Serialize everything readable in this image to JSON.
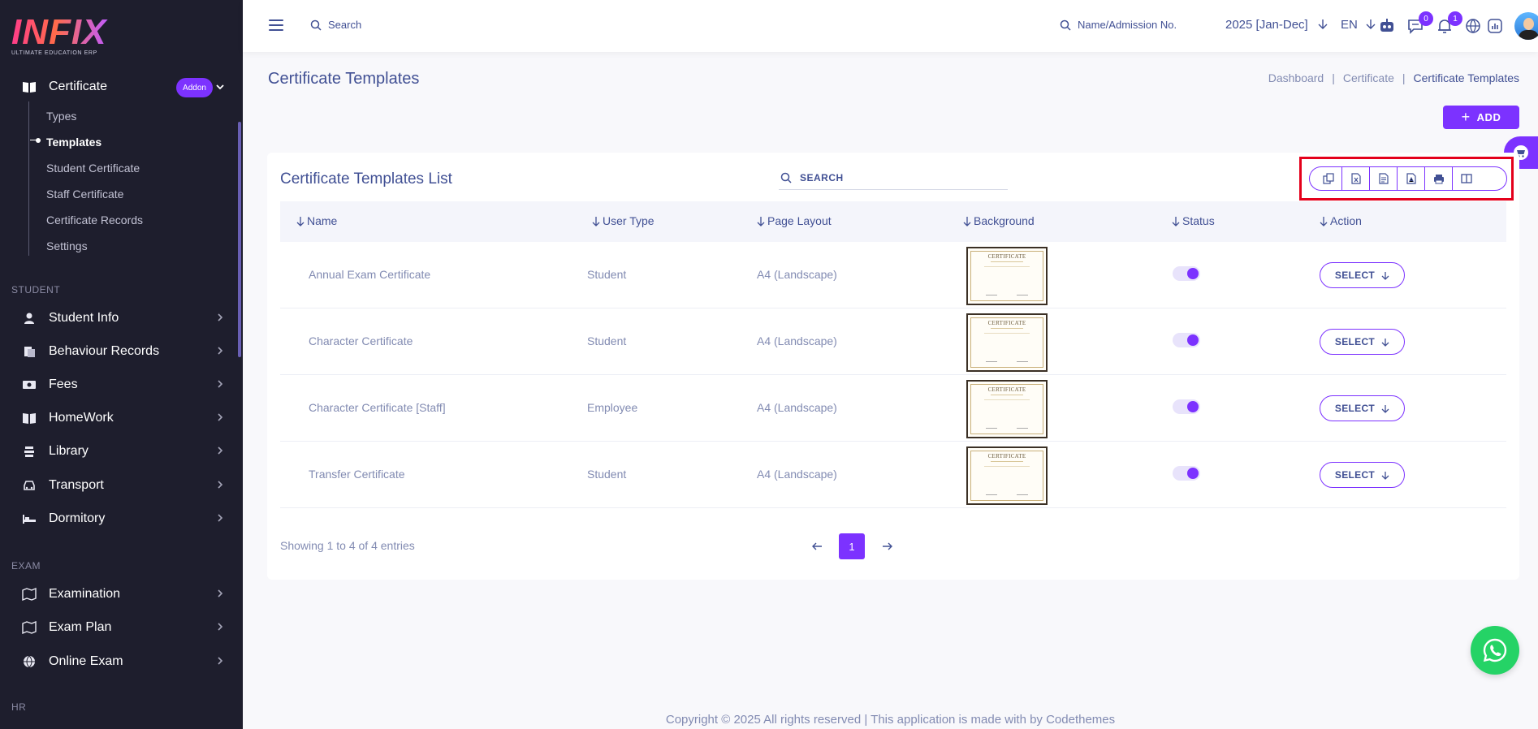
{
  "brand": {
    "name": "INFIX",
    "tagline": "ULTIMATE EDUCATION ERP"
  },
  "sidebar": {
    "certificate": {
      "label": "Certificate",
      "badge": "Addon"
    },
    "sub_items": [
      "Types",
      "Templates",
      "Student Certificate",
      "Staff Certificate",
      "Certificate Records",
      "Settings"
    ],
    "active_sub": "Templates",
    "sections": {
      "student": "STUDENT",
      "exam": "EXAM",
      "hr": "HR"
    },
    "student_items": [
      "Student Info",
      "Behaviour Records",
      "Fees",
      "HomeWork",
      "Library",
      "Transport",
      "Dormitory"
    ],
    "exam_items": [
      "Examination",
      "Exam Plan",
      "Online Exam"
    ]
  },
  "topbar": {
    "search_label": "Search",
    "name_search_label": "Name/Admission No.",
    "year": "2025 [Jan-Dec]",
    "lang": "EN",
    "chat_badge": "0",
    "notif_badge": "1"
  },
  "page": {
    "title": "Certificate Templates",
    "breadcrumb": [
      "Dashboard",
      "Certificate",
      "Certificate Templates"
    ],
    "add_label": "ADD"
  },
  "card": {
    "title": "Certificate Templates List",
    "search_label": "SEARCH",
    "columns": [
      "Name",
      "User Type",
      "Page Layout",
      "Background",
      "Status",
      "Action"
    ],
    "rows": [
      {
        "name": "Annual Exam Certificate",
        "user_type": "Student",
        "layout": "A4 (Landscape)",
        "status": true,
        "action": "SELECT"
      },
      {
        "name": "Character Certificate",
        "user_type": "Student",
        "layout": "A4 (Landscape)",
        "status": true,
        "action": "SELECT"
      },
      {
        "name": "Character Certificate [Staff]",
        "user_type": "Employee",
        "layout": "A4 (Landscape)",
        "status": true,
        "action": "SELECT"
      },
      {
        "name": "Transfer Certificate",
        "user_type": "Student",
        "layout": "A4 (Landscape)",
        "status": true,
        "action": "SELECT"
      }
    ],
    "thumb_text": "CERTIFICATE",
    "showing": "Showing 1 to 4 of 4 entries",
    "current_page": "1"
  },
  "footer": "Copyright © 2025 All rights reserved | This application is made with by Codethemes",
  "colors": {
    "accent": "#7c32ff",
    "sidebar_bg": "#1e1e2d",
    "text": "#415094",
    "muted": "#828bb2",
    "highlight": "#e4001b"
  }
}
